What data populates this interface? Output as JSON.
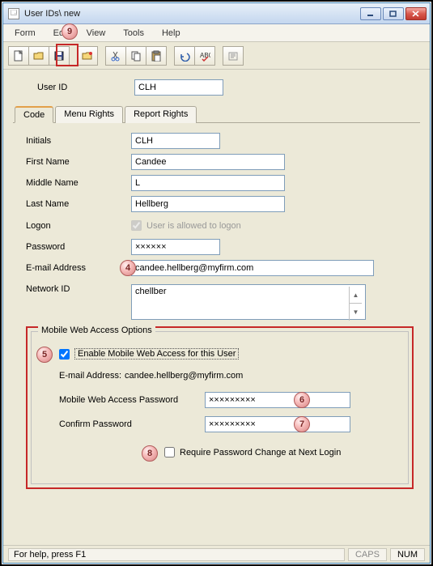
{
  "window": {
    "title": "User IDs\\ new"
  },
  "menubar": {
    "items": [
      "Form",
      "Edit",
      "View",
      "Tools",
      "Help"
    ]
  },
  "user_id": {
    "label": "User ID",
    "value": "CLH"
  },
  "tabs": {
    "items": [
      "Code",
      "Menu Rights",
      "Report Rights"
    ],
    "active": 0
  },
  "code_tab": {
    "initials": {
      "label": "Initials",
      "value": "CLH"
    },
    "first_name": {
      "label": "First Name",
      "value": "Candee"
    },
    "middle_name": {
      "label": "Middle Name",
      "value": "L"
    },
    "last_name": {
      "label": "Last Name",
      "value": "Hellberg"
    },
    "logon": {
      "label": "Logon",
      "checkbox_label": "User is allowed to logon",
      "checked": true
    },
    "password": {
      "label": "Password",
      "value": "××××××"
    },
    "email": {
      "label": "E-mail Address",
      "value": "candee.hellberg@myfirm.com"
    },
    "network_id": {
      "label": "Network ID",
      "value": "chellber"
    }
  },
  "mobile_group": {
    "legend": "Mobile Web Access Options",
    "enable_label": "Enable Mobile Web Access for this User",
    "enable_checked": true,
    "email_label": "E-mail Address:",
    "email_value": "candee.hellberg@myfirm.com",
    "password_label": "Mobile Web Access Password",
    "password_value": "×××××××××",
    "confirm_label": "Confirm Password",
    "confirm_value": "×××××××××",
    "require_change_label": "Require Password Change at Next Login",
    "require_change_checked": false
  },
  "status": {
    "help": "For help, press F1",
    "caps": "CAPS",
    "num": "NUM"
  },
  "callouts": {
    "c4": "4",
    "c5": "5",
    "c6": "6",
    "c7": "7",
    "c8": "8",
    "c9": "9"
  }
}
